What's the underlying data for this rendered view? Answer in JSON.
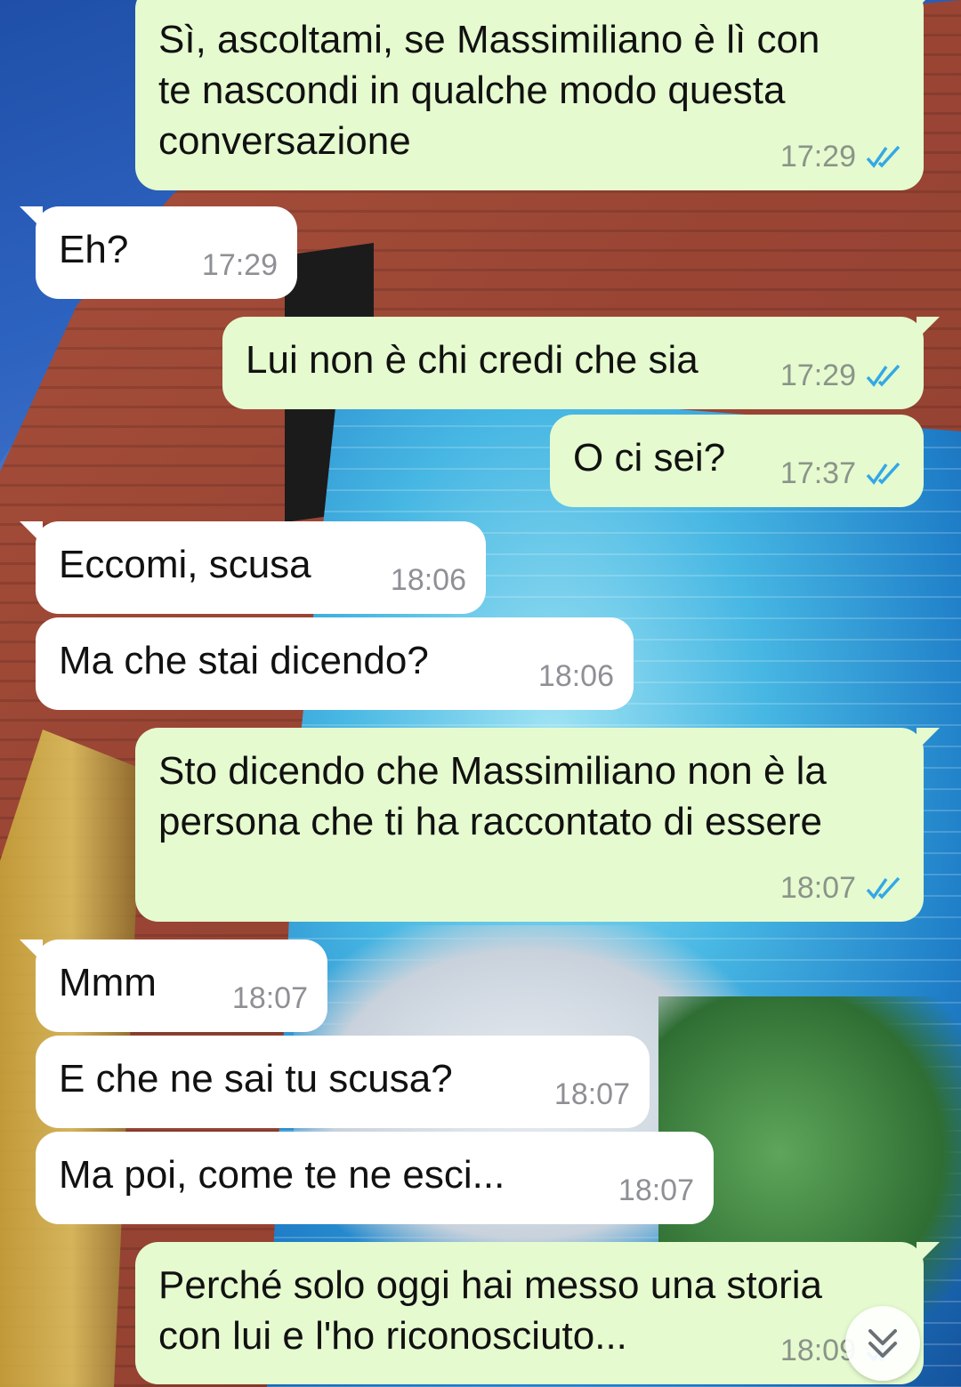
{
  "messages": [
    {
      "dir": "out",
      "text": "Sì, ascoltami, se Massimiliano è lì con\nte nascondi in qualche modo questa\nconversazione",
      "time": "17:29",
      "status": "read"
    },
    {
      "dir": "in",
      "text": "Eh?",
      "time": "17:29"
    },
    {
      "dir": "out",
      "text": "Lui non è chi credi che sia",
      "time": "17:29",
      "status": "read"
    },
    {
      "dir": "out",
      "text": "O ci sei?",
      "time": "17:37",
      "status": "read"
    },
    {
      "dir": "in",
      "text": "Eccomi, scusa",
      "time": "18:06"
    },
    {
      "dir": "in",
      "text": "Ma che stai dicendo?",
      "time": "18:06"
    },
    {
      "dir": "out",
      "text": "Sto dicendo che Massimiliano non è la\npersona che ti ha raccontato di essere",
      "time": "18:07",
      "status": "read"
    },
    {
      "dir": "in",
      "text": "Mmm",
      "time": "18:07"
    },
    {
      "dir": "in",
      "text": "E che ne sai tu scusa?",
      "time": "18:07"
    },
    {
      "dir": "in",
      "text": "Ma poi, come te ne esci...",
      "time": "18:07"
    },
    {
      "dir": "out",
      "text": "Perché solo oggi hai messo una storia\ncon lui e l'ho riconosciuto...",
      "time": "18:09",
      "status": "read"
    }
  ],
  "colors": {
    "outgoing_bubble": "#e5fbcf",
    "incoming_bubble": "#ffffff",
    "read_ticks": "#34a8e6"
  },
  "icons": {
    "read_receipt": "double-check-icon",
    "scroll": "double-chevron-down-icon"
  }
}
